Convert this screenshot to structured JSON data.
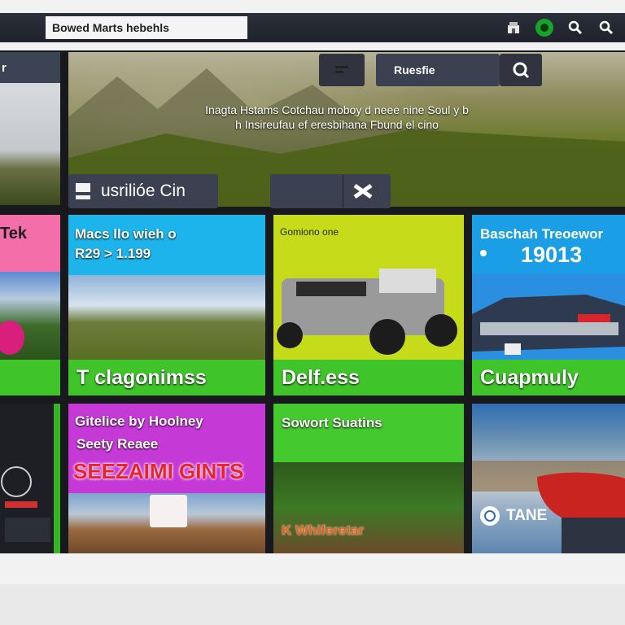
{
  "app": {
    "title": "Bowed Marts hebehls"
  },
  "header": {
    "icons": [
      "shop-icon",
      "green-circle-icon",
      "search-icon",
      "search-icon-2"
    ]
  },
  "left_column": {
    "header_label": "r",
    "tile1_label": "Tek"
  },
  "hero": {
    "text_line1": "Inagta Hstams Cotchau moboy d neee nine Soul y b",
    "text_line2": "h Insireufau ef eresbihana Fbund el cino",
    "search_placeholder": "Ruesfie",
    "secondary_button": "usrilióe Cin"
  },
  "tiles": [
    {
      "title": "Macs llo wieh o",
      "subtitle": "R29 > 1.199",
      "band": "T clagonimss",
      "color": "#1db4ec"
    },
    {
      "title": "Gomiono one",
      "band": "Delf.ess",
      "color": "#c6dc1a"
    },
    {
      "title": "Baschah Treoewor",
      "subtitle": "19013",
      "band": "Cuapmuly",
      "color": "#1a9fe6"
    },
    {
      "title": "Gitelice by Hoolney",
      "subtitle": "Seety Reaee",
      "overlay": "SEEZAIMI GINTS",
      "color": "#c53ad6"
    },
    {
      "title": "Sowort Suatins",
      "footer": "K Whiferetar",
      "color": "#44c92e"
    },
    {
      "label": "TANE"
    }
  ]
}
